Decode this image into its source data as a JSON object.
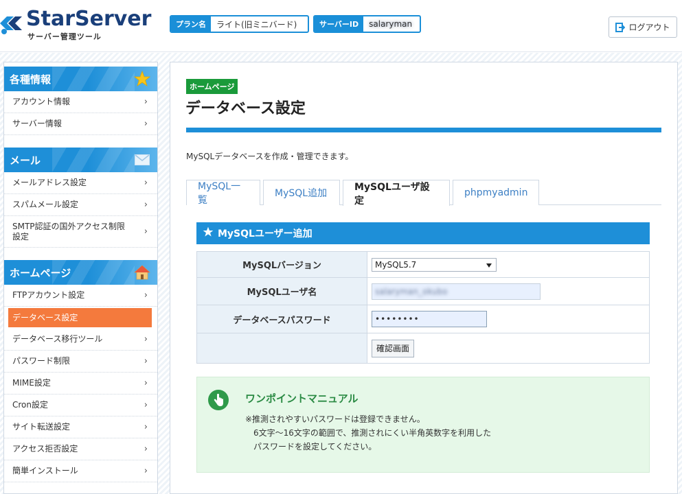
{
  "header": {
    "logo_title": "StarServer",
    "logo_subtitle": "サーバー管理ツール",
    "plan_label": "プラン名",
    "plan_value": "ライト(旧ミニバード)",
    "server_id_label": "サーバーID",
    "server_id_value": "salaryman",
    "logout_label": "ログアウト"
  },
  "sidebar": {
    "groups": [
      {
        "title": "各種情報",
        "icon": "star-icon",
        "items": [
          {
            "label": "アカウント情報"
          },
          {
            "label": "サーバー情報"
          }
        ]
      },
      {
        "title": "メール",
        "icon": "mail-icon",
        "items": [
          {
            "label": "メールアドレス設定"
          },
          {
            "label": "スパムメール設定"
          },
          {
            "label": "SMTP認証の国外アクセス制限設定"
          }
        ]
      },
      {
        "title": "ホームページ",
        "icon": "home-icon",
        "items": [
          {
            "label": "FTPアカウント設定"
          },
          {
            "label": "データベース設定"
          },
          {
            "label": "データベース移行ツール"
          },
          {
            "label": "パスワード制限"
          },
          {
            "label": "MIME設定"
          },
          {
            "label": "Cron設定"
          },
          {
            "label": "サイト転送設定"
          },
          {
            "label": "アクセス拒否設定"
          },
          {
            "label": "簡単インストール"
          }
        ]
      }
    ],
    "chevron": "›"
  },
  "main": {
    "category_badge": "ホームページ",
    "page_title": "データベース設定",
    "description": "MySQLデータベースを作成・管理できます。",
    "tabs": [
      {
        "label": "MySQL一覧"
      },
      {
        "label": "MySQL追加"
      },
      {
        "label": "MySQLユーザ設定"
      },
      {
        "label": "phpmyadmin"
      }
    ],
    "active_tab": "MySQLユーザ設定",
    "section_title": "MySQLユーザー追加",
    "form": {
      "version_label": "MySQLバージョン",
      "version_value": "MySQL5.7",
      "username_label": "MySQLユーザ名",
      "username_value": "salaryman_okubo",
      "password_label": "データベースパスワード",
      "password_value": "••••••••",
      "confirm_button": "確認画面"
    },
    "manual": {
      "title": "ワンポイントマニュアル",
      "line1": "※推測されやすいパスワードは登録できません。",
      "line2": "6文字～16文字の範囲で、推測されにくい半角英数字を利用した",
      "line3": "パスワードを設定してください。"
    }
  },
  "colors": {
    "primary_blue": "#1e8fd8",
    "active_orange": "#f47a3d",
    "badge_green": "#1a9a3a",
    "manual_bg": "#e6f8e8"
  }
}
